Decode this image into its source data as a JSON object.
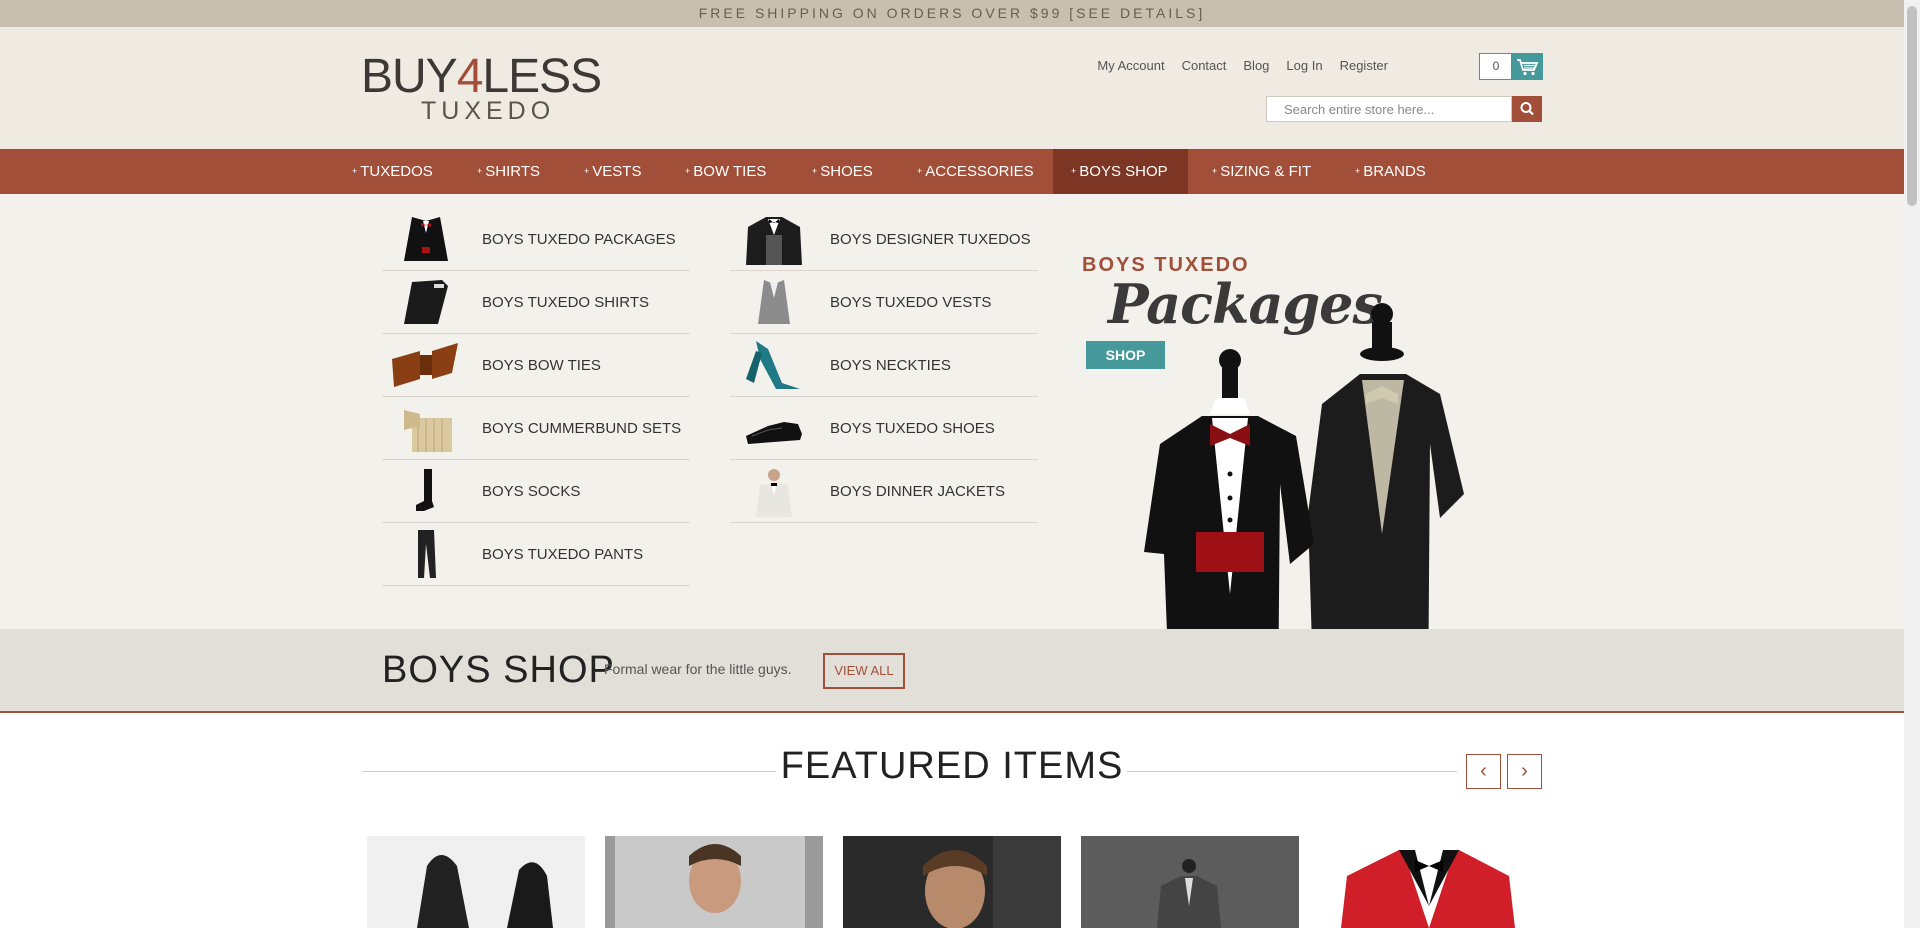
{
  "promo_bar": {
    "text": "FREE SHIPPING ON ORDERS OVER $99 [SEE DETAILS]"
  },
  "logo": {
    "line1_a": "BUY",
    "line1_b": "4",
    "line1_c": "LESS",
    "line2": "TUXEDO"
  },
  "header": {
    "links": [
      "My Account",
      "Contact",
      "Blog",
      "Log In",
      "Register"
    ],
    "cart_count": "0",
    "search_placeholder": "Search entire store here..."
  },
  "nav": {
    "bullet": "+",
    "items": [
      "TUXEDOS",
      "SHIRTS",
      "VESTS",
      "BOW TIES",
      "SHOES",
      "ACCESSORIES",
      "BOYS SHOP",
      "SIZING & FIT",
      "BRANDS"
    ],
    "active": "BOYS SHOP"
  },
  "mega_menu": {
    "left": [
      "BOYS TUXEDO PACKAGES",
      "BOYS TUXEDO SHIRTS",
      "BOYS BOW TIES",
      "BOYS CUMMERBUND SETS",
      "BOYS SOCKS",
      "BOYS TUXEDO PANTS"
    ],
    "right": [
      "BOYS DESIGNER TUXEDOS",
      "BOYS TUXEDO VESTS",
      "BOYS NECKTIES",
      "BOYS TUXEDO SHOES",
      "BOYS DINNER JACKETS"
    ]
  },
  "promo": {
    "line1": "BOYS TUXEDO",
    "line2": "Packages",
    "button": "SHOP"
  },
  "band": {
    "title": "BOYS SHOP",
    "tagline": "Formal wear for the little guys.",
    "button": "VIEW ALL"
  },
  "featured": {
    "title": "FEATURED ITEMS",
    "prev": "‹",
    "next": "›"
  },
  "colors": {
    "brand": "#a24f39",
    "accent": "#46999b",
    "background": "#efeae2"
  }
}
